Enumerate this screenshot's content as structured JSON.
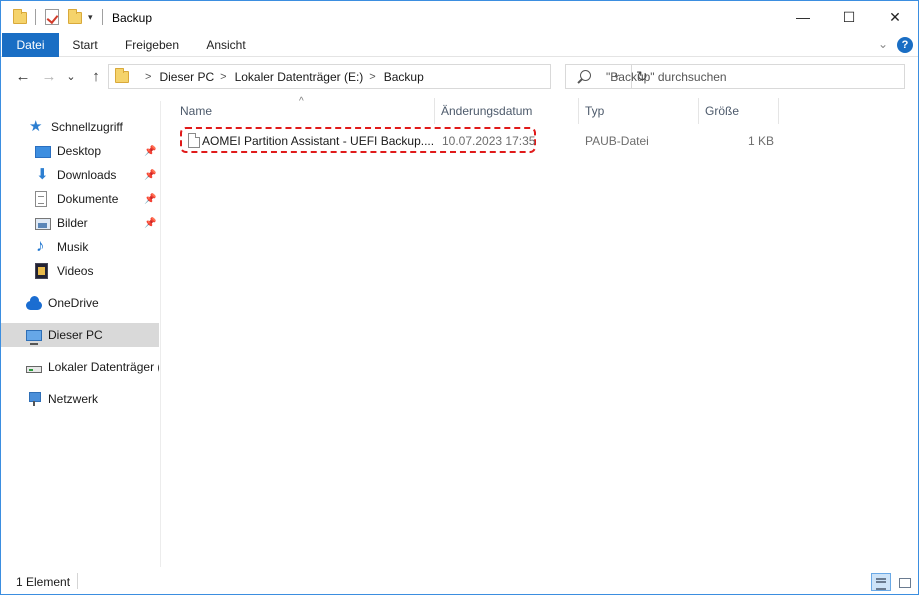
{
  "window": {
    "title": "Backup",
    "minimize": "—",
    "maximize": "☐",
    "close": "✕"
  },
  "ribbon": {
    "tabs": [
      "Datei",
      "Start",
      "Freigeben",
      "Ansicht"
    ],
    "expand_icon": "chevron-down-icon",
    "help": "?"
  },
  "nav": {
    "back": "←",
    "forward": "→",
    "recent": "⌄",
    "up": "↑"
  },
  "address": {
    "crumbs": [
      "Dieser PC",
      "Lokaler Datenträger (E:)",
      "Backup"
    ],
    "separator": ">",
    "dropdown": "⌄",
    "refresh": "↻"
  },
  "search": {
    "placeholder": "\"Backup\" durchsuchen"
  },
  "sidebar": {
    "items": [
      {
        "label": "Schnellzugriff",
        "icon": "star-icon"
      },
      {
        "label": "Desktop",
        "icon": "desktop-icon",
        "pinned": true
      },
      {
        "label": "Downloads",
        "icon": "download-icon",
        "pinned": true
      },
      {
        "label": "Dokumente",
        "icon": "document-icon",
        "pinned": true
      },
      {
        "label": "Bilder",
        "icon": "pictures-icon",
        "pinned": true
      },
      {
        "label": "Musik",
        "icon": "music-icon"
      },
      {
        "label": "Videos",
        "icon": "video-icon"
      },
      {
        "label": "OneDrive",
        "icon": "cloud-icon"
      },
      {
        "label": "Dieser PC",
        "icon": "computer-icon",
        "selected": true
      },
      {
        "label": "Lokaler Datenträger (",
        "icon": "drive-icon"
      },
      {
        "label": "Netzwerk",
        "icon": "network-icon"
      }
    ],
    "pin_glyph": "📌"
  },
  "filelist": {
    "sort_indicator": "^",
    "columns": [
      "Name",
      "Änderungsdatum",
      "Typ",
      "Größe"
    ],
    "rows": [
      {
        "name": "AOMEI Partition Assistant - UEFI Backup....",
        "date": "10.07.2023 17:35",
        "type": "PAUB-Datei",
        "size": "1 KB"
      }
    ],
    "highlight_color": "#e01a1a"
  },
  "status": {
    "count": "1 Element"
  },
  "colors": {
    "accent": "#1a6ec4",
    "selection": "#d9d9d9"
  }
}
